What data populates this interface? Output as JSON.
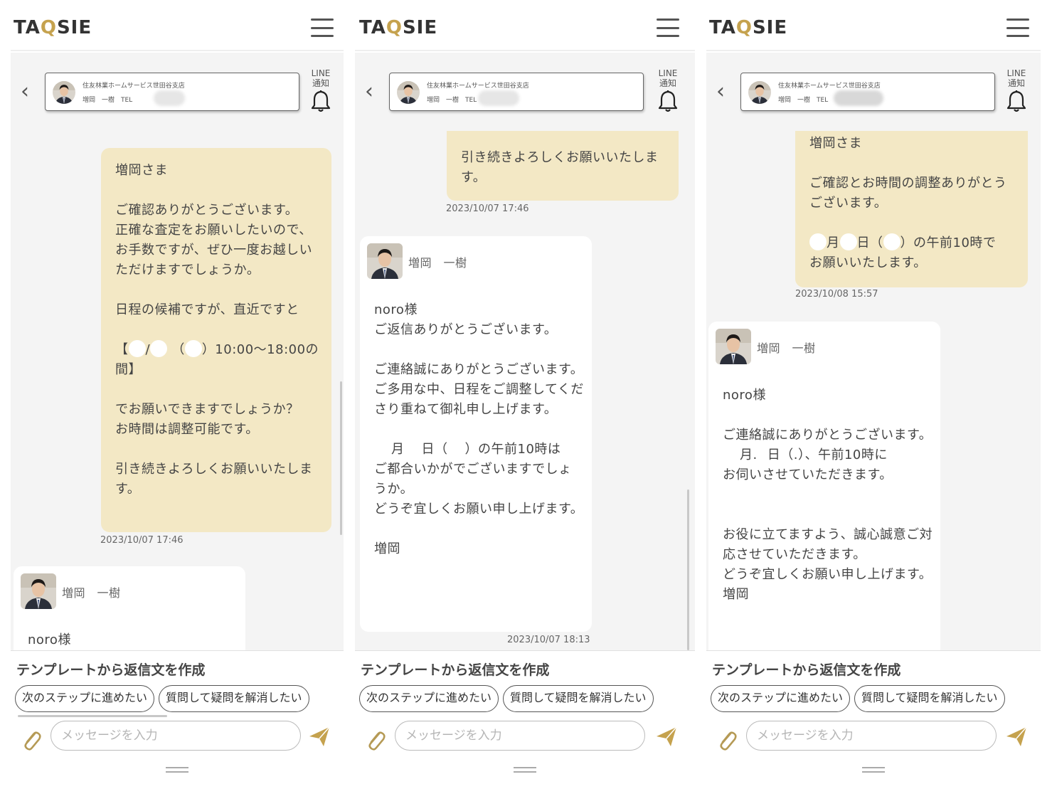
{
  "brand": {
    "logo_pre": "TA",
    "logo_q": "Q",
    "logo_post": "SIE",
    "accent": "#c5a24e"
  },
  "contact": {
    "company": "住友林業ホームサービス世田谷支店",
    "name_line": "増岡　一樹　TEL",
    "line_label_1": "LINE",
    "line_label_2": "通知"
  },
  "sender": {
    "name": "増岡　一樹"
  },
  "bottom": {
    "heading": "テンプレートから返信文を作成",
    "chip_1": "次のステップに進めたい",
    "chip_2": "質問して疑問を解消したい",
    "placeholder": "メッセージを入力"
  },
  "panels": [
    {
      "mine": {
        "l1": "増岡さま",
        "l2": "ご確認ありがとうございます。\n正確な査定をお願いしたいので、\nお手数ですが、ぜひ一度お越しいただけますでしょうか。",
        "l3": "日程の候補ですが、直近ですと",
        "l4a": "【",
        "l4b": "/",
        "l4c": "（",
        "l4d": "）10:00〜18:00の",
        "l4e": "間】",
        "l5": "でお願いできますでしょうか？\nお時間は調整可能です。",
        "l6": "引き続きよろしくお願いいたします。",
        "ts": "2023/10/07 17:46"
      },
      "other_greeting": "noro様"
    },
    {
      "mine": {
        "text": "引き続きよろしくお願いいたします。",
        "ts": "2023/10/07 17:46"
      },
      "other": {
        "l1": "noro様\nご返信ありがとうございます。",
        "l2": "ご連絡誠にありがとうございます。\nご多用な中、日程をご調整してくださり重ねて御礼申し上げます。",
        "l3a": "月",
        "l3b": "日（",
        "l3c": "）の午前10時は",
        "l3d": "ご都合いかがでございますでしょうか。\nどうぞ宜しくお願い申し上げます。",
        "l4": "増岡",
        "ts": "2023/10/07 18:13"
      }
    },
    {
      "mine": {
        "l1": "増岡さま",
        "l2": "ご確認とお時間の調整ありがとうございます。",
        "l3a": "月",
        "l3b": "日（",
        "l3c": "）の午前10時で",
        "l3d": "お願いいたします。",
        "ts": "2023/10/08 15:57"
      },
      "other": {
        "l1": "noro様",
        "l2": "ご連絡誠にありがとうございます。",
        "l3a": "月.",
        "l3b": "日（.",
        "l3c": "）、午前10時に",
        "l3d": "お伺いさせていただきます。",
        "l4": "お役に立てますよう、誠心誠意ご対応させていただきます。\nどうぞ宜しくお願い申し上げます。\n増岡"
      }
    }
  ]
}
